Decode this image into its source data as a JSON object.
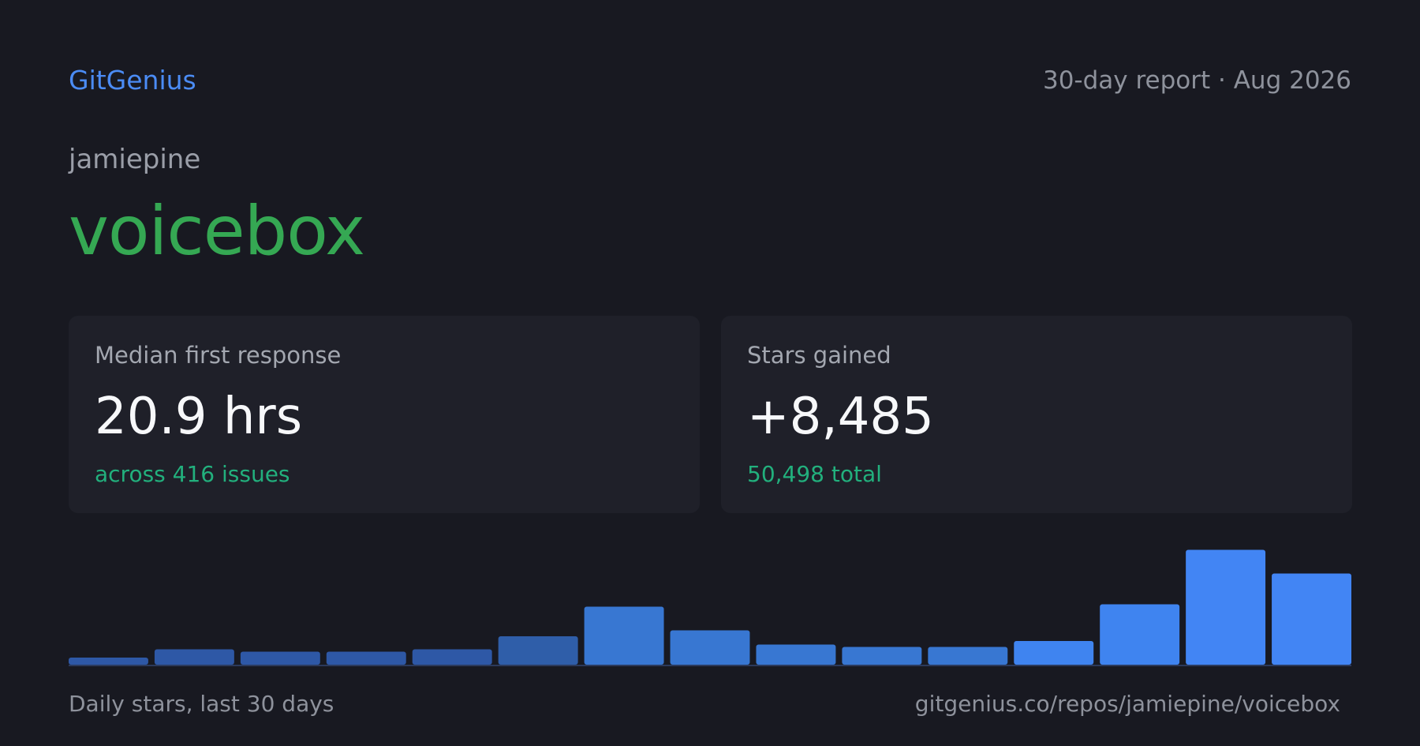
{
  "header": {
    "brand": "GitGenius",
    "report": "30-day report · Aug 2026"
  },
  "repo": {
    "owner": "jamiepine",
    "name": "voicebox"
  },
  "cards": {
    "response": {
      "label": "Median first response",
      "value": "20.9 hrs",
      "sub": "across 416 issues"
    },
    "stars": {
      "label": "Stars gained",
      "value": "+8,485",
      "sub": "50,498 total"
    }
  },
  "footer": {
    "caption": "Daily stars, last 30 days",
    "url": "gitgenius.co/repos/jamiepine/voicebox"
  },
  "colors": {
    "accent_blue": "#4b8cf5",
    "repo_green": "#35a853",
    "sub_green": "#22b07d",
    "background": "#181921",
    "card": "#1f2029"
  },
  "chart_data": {
    "type": "bar",
    "categories": [
      "1",
      "2",
      "3",
      "4",
      "5",
      "6",
      "7",
      "8",
      "9",
      "10",
      "11",
      "12",
      "13",
      "14",
      "15"
    ],
    "values": [
      60,
      130,
      110,
      110,
      130,
      240,
      490,
      290,
      170,
      150,
      150,
      200,
      510,
      970,
      770
    ],
    "colors": [
      "#2e58a6",
      "#2e58a6",
      "#2e58a6",
      "#2e58a6",
      "#2e58a6",
      "#2f5ea9",
      "#3877d2",
      "#3877d2",
      "#3877d2",
      "#3877d2",
      "#3877d2",
      "#3f84f0",
      "#3f84f0",
      "#4285f4",
      "#4285f4"
    ],
    "ylim": [
      0,
      1000
    ]
  }
}
